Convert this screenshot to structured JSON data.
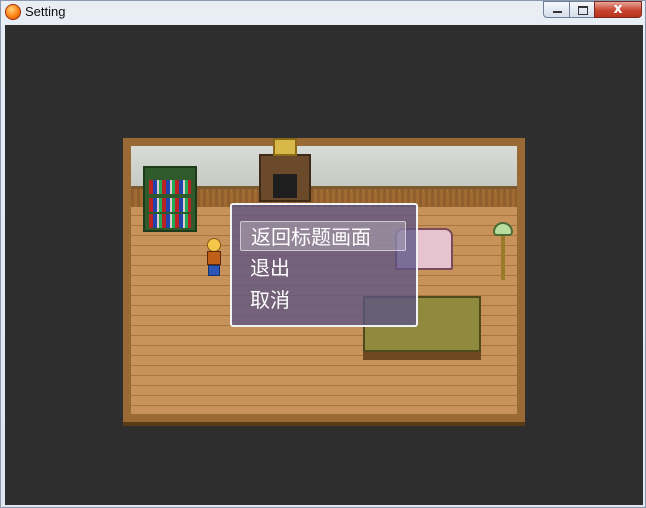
{
  "window": {
    "title": "Setting",
    "close_glyph": "x",
    "icons": [
      "app-icon",
      "minimize-icon",
      "maximize-icon",
      "close-icon"
    ]
  },
  "menu": {
    "items": [
      {
        "label": "返回标题画面",
        "selected": true
      },
      {
        "label": "退出",
        "selected": false
      },
      {
        "label": "取消",
        "selected": false
      }
    ]
  }
}
